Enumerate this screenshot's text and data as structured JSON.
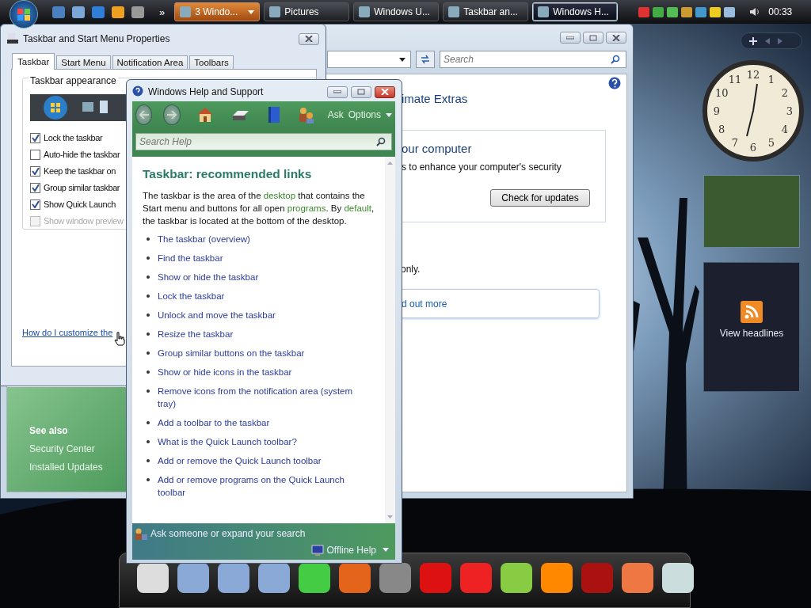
{
  "taskbar": {
    "overflow": "»",
    "clock": "00:33",
    "tasks": [
      {
        "label": "3 Windo...",
        "selected": false,
        "flashing": true,
        "grouped": true
      },
      {
        "label": "Pictures",
        "selected": false,
        "flashing": false,
        "grouped": false
      },
      {
        "label": "Windows U...",
        "selected": false,
        "flashing": false,
        "grouped": false
      },
      {
        "label": "Taskbar an...",
        "selected": false,
        "flashing": false,
        "grouped": false
      },
      {
        "label": "Windows H...",
        "selected": true,
        "flashing": false,
        "grouped": false
      }
    ]
  },
  "update_window": {
    "search": {
      "placeholder": "Search"
    },
    "heading": "imate Extras",
    "panel": {
      "title": "our computer",
      "text": "s to enhance your computer's security",
      "button": "Check for updates"
    },
    "note": "only.",
    "link": "d out more",
    "see_also": {
      "heading": "See also",
      "links": [
        "Security Center",
        "Installed Updates"
      ]
    }
  },
  "properties_window": {
    "title": "Taskbar and Start Menu Properties",
    "tabs": [
      {
        "label": "Taskbar",
        "selected": true
      },
      {
        "label": "Start Menu",
        "selected": false
      },
      {
        "label": "Notification Area",
        "selected": false
      },
      {
        "label": "Toolbars",
        "selected": false
      }
    ],
    "group_label": "Taskbar appearance",
    "options": [
      {
        "label": "Lock the taskbar",
        "checked": true,
        "disabled": false
      },
      {
        "label": "Auto-hide the taskbar",
        "checked": false,
        "disabled": false
      },
      {
        "label": "Keep the taskbar on",
        "checked": true,
        "disabled": false
      },
      {
        "label": "Group similar taskbar",
        "checked": true,
        "disabled": false
      },
      {
        "label": "Show Quick Launch",
        "checked": true,
        "disabled": false
      },
      {
        "label": "Show window preview",
        "checked": false,
        "disabled": true
      }
    ],
    "link": "How do I customize the"
  },
  "help_window": {
    "title": "Windows Help and Support",
    "ask": "Ask",
    "options": "Options",
    "search": {
      "placeholder": "Search Help"
    },
    "heading": "Taskbar: recommended links",
    "paragraph": [
      {
        "text": "The taskbar is the area of the ",
        "kind": "plain"
      },
      {
        "text": "desktop",
        "kind": "term"
      },
      {
        "text": " that contains the Start menu and buttons for all open ",
        "kind": "plain"
      },
      {
        "text": "programs",
        "kind": "term"
      },
      {
        "text": ". By ",
        "kind": "plain"
      },
      {
        "text": "default",
        "kind": "term"
      },
      {
        "text": ", the taskbar is located at the bottom of the desktop.",
        "kind": "plain"
      }
    ],
    "links": [
      "The taskbar (overview)",
      "Find the taskbar",
      "Show or hide the taskbar",
      "Lock the taskbar",
      "Unlock and move the taskbar",
      "Resize the taskbar",
      "Group similar buttons on the taskbar",
      "Show or hide icons in the taskbar",
      "Remove icons from the notification area (system tray)",
      "Add a toolbar to the taskbar",
      "What is the Quick Launch toolbar?",
      "Add or remove the Quick Launch toolbar",
      "Add or remove programs on the Quick Launch toolbar"
    ],
    "footer": {
      "ask": "Ask someone or expand your search",
      "offline": "Offline Help"
    }
  },
  "gadgets": {
    "clock_numerals": [
      "12",
      "1",
      "2",
      "3",
      "4",
      "5",
      "6",
      "7",
      "8",
      "9",
      "10",
      "11"
    ],
    "feed": {
      "label": "View headlines"
    }
  }
}
